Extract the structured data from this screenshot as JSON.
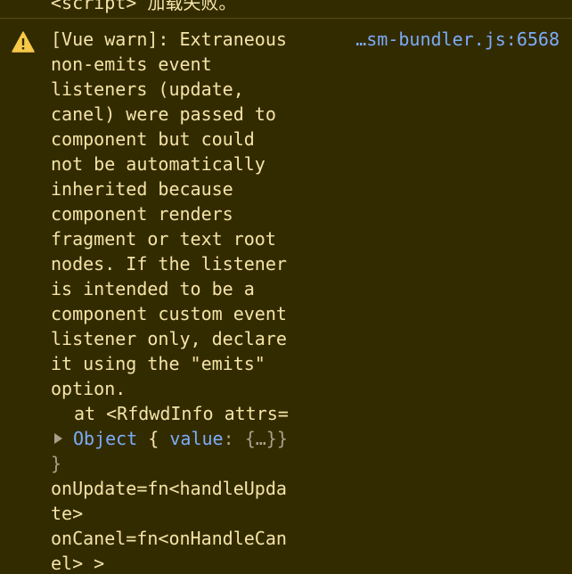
{
  "previous_message": {
    "text": "<script> 加载失败。"
  },
  "warning": {
    "icon": "warning-triangle-icon",
    "source": "…sm-bundler.js:6568",
    "message_lines": [
      "[Vue warn]: Extraneous",
      "non-emits event",
      "listeners (update,",
      "canel) were passed to",
      "component but could",
      "not be automatically",
      "inherited because",
      "component renders",
      "fragment or text root",
      "nodes. If the listener",
      "is intended to be a",
      "component custom event",
      "listener only, declare",
      "it using the \"emits\"",
      "option."
    ],
    "trace": {
      "at_line": "at <RfdwdInfo attrs=",
      "object_type": "Object",
      "object_open": "{",
      "object_key": "value",
      "object_colon": ":",
      "object_preview": "{…}",
      "object_close": "}",
      "close_brace": "}",
      "handler_lines": [
        "onUpdate=fn<handleUpda",
        "te>",
        "onCanel=fn<onHandleCan",
        "el> >"
      ]
    },
    "colors": {
      "background": "#332b00",
      "text": "#f4e4a8",
      "link": "#7cacf8",
      "icon": "#f7c948"
    }
  }
}
